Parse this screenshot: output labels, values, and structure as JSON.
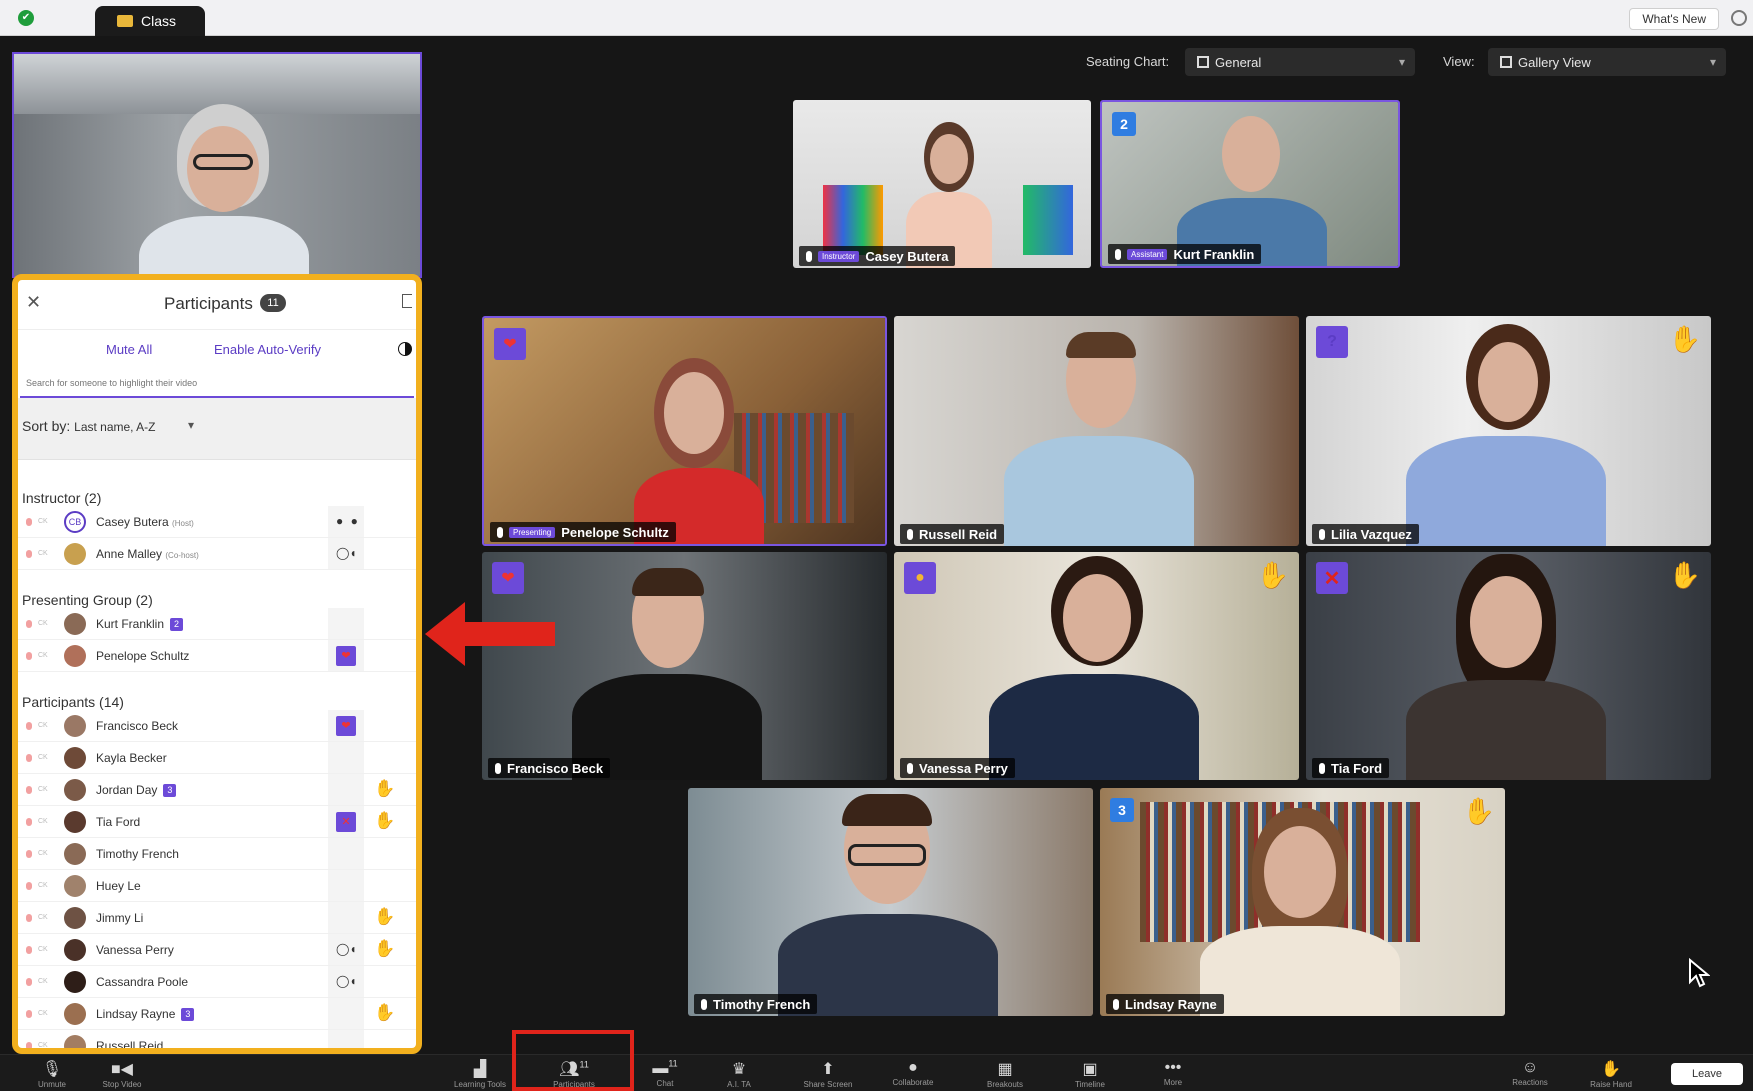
{
  "tab": {
    "title": "Class"
  },
  "whats_new": "What's New",
  "seating": {
    "label": "Seating Chart:",
    "value": "General"
  },
  "view": {
    "label": "View:",
    "value": "Gallery View"
  },
  "presenter_name": "Anne Malley",
  "stage": [
    {
      "name": "Casey Butera",
      "role": "Instructor"
    },
    {
      "name": "Kurt Franklin",
      "role": "Assistant",
      "group": "2"
    }
  ],
  "tiles": [
    {
      "name": "Penelope Schultz",
      "tag": "Presenting",
      "reaction": "heart"
    },
    {
      "name": "Russell Reid"
    },
    {
      "name": "Lilia Vazquez",
      "reaction": "question",
      "hand": true
    },
    {
      "name": "Francisco Beck",
      "reaction": "heart"
    },
    {
      "name": "Vanessa Perry",
      "reaction": "clap",
      "hand": true
    },
    {
      "name": "Tia Ford",
      "reaction": "x",
      "hand": true
    },
    {
      "name": "Timothy French"
    },
    {
      "name": "Lindsay Rayne",
      "group": "3",
      "hand": true
    }
  ],
  "panel": {
    "title": "Participants",
    "count": "11",
    "mute_all": "Mute All",
    "auto_verify": "Enable Auto-Verify",
    "search_placeholder": "Search for someone to highlight their video",
    "sort_label": "Sort by:",
    "sort_value": "Last name, A-Z",
    "groups": [
      {
        "label": "Instructor (2)",
        "rows": [
          {
            "name": "Casey Butera",
            "role": "(Host)",
            "avatar_text": "CB"
          },
          {
            "name": "Anne Malley",
            "role": "(Co-host)"
          }
        ]
      },
      {
        "label": "Presenting Group (2)",
        "rows": [
          {
            "name": "Kurt Franklin",
            "group": "2"
          },
          {
            "name": "Penelope Schultz",
            "reaction": "heart"
          }
        ]
      },
      {
        "label": "Participants (14)",
        "rows": [
          {
            "name": "Francisco Beck",
            "reaction": "heart"
          },
          {
            "name": "Kayla Becker"
          },
          {
            "name": "Jordan Day",
            "group": "3",
            "hand": true
          },
          {
            "name": "Tia Ford",
            "reaction": "x",
            "hand": true
          },
          {
            "name": "Timothy French"
          },
          {
            "name": "Huey Le"
          },
          {
            "name": "Jimmy Li",
            "hand": true
          },
          {
            "name": "Vanessa Perry",
            "speaking": true,
            "hand": true
          },
          {
            "name": "Cassandra Poole",
            "speaking": true
          },
          {
            "name": "Lindsay Rayne",
            "group": "3",
            "hand": true
          },
          {
            "name": "Russell Reid"
          }
        ]
      }
    ]
  },
  "toolbar": {
    "unmute": "Unmute",
    "stop_video": "Stop Video",
    "learning_tools": "Learning Tools",
    "participants": "Participants",
    "participants_count": "11",
    "chat": "Chat",
    "chat_count": "11",
    "ai_ta": "A.I. TA",
    "share_screen": "Share Screen",
    "collaborate": "Collaborate",
    "breakouts": "Breakouts",
    "timeline": "Timeline",
    "more": "More",
    "reactions": "Reactions",
    "raise_hand": "Raise Hand",
    "leave": "Leave"
  }
}
